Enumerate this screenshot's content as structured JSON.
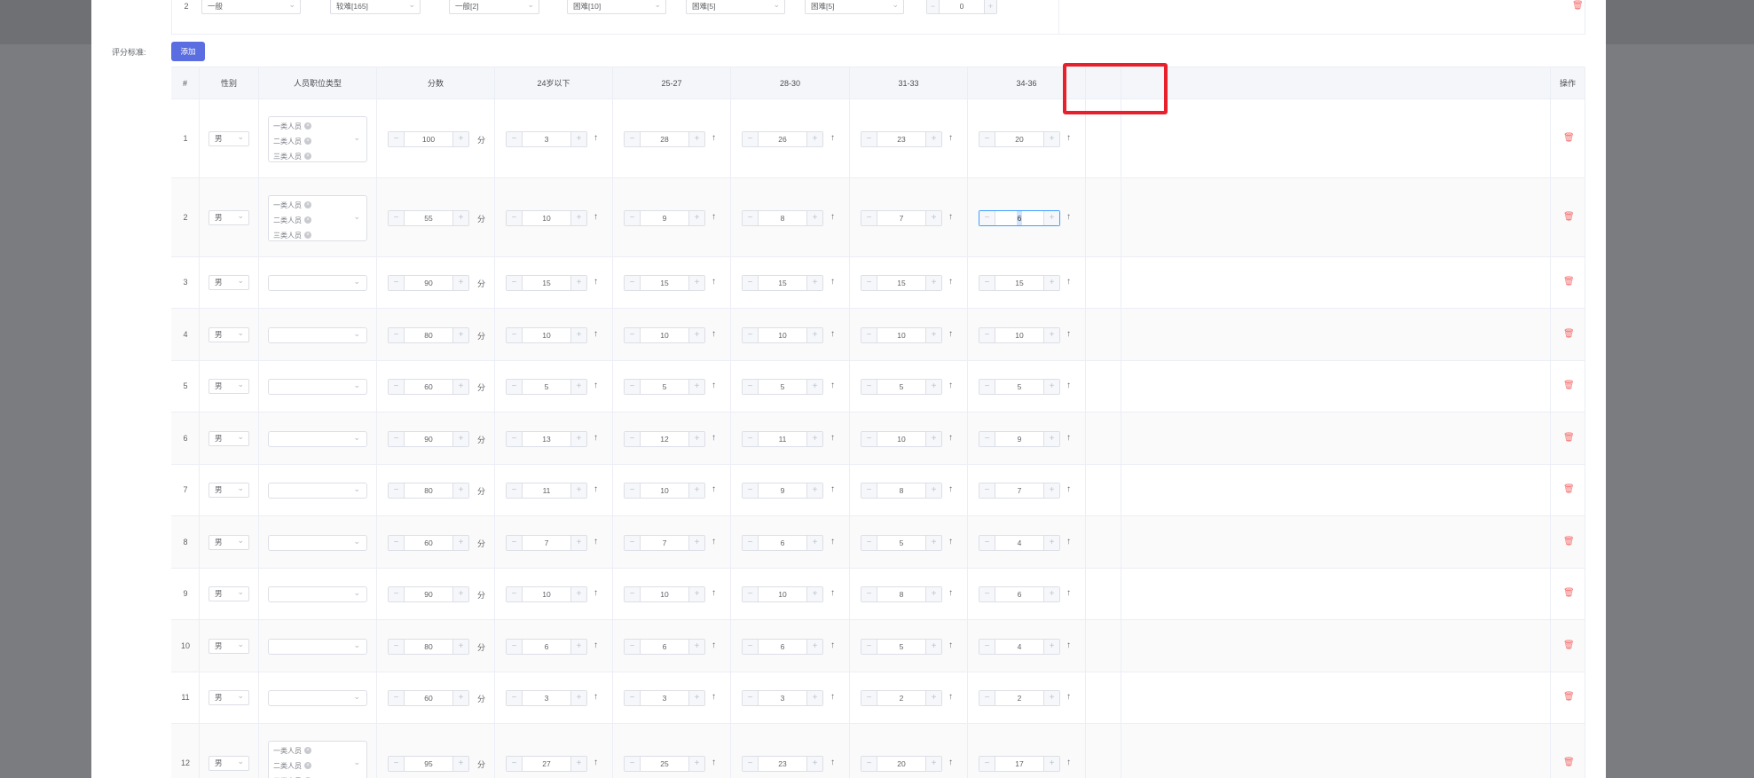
{
  "top_row": {
    "index": "2",
    "selects": [
      "一般",
      "较难[165]",
      "一般[2]",
      "困难[10]",
      "困难[5]",
      "困难[5]"
    ],
    "number": "0"
  },
  "scoring": {
    "label": "评分标准:",
    "add_button": "添加"
  },
  "columns": {
    "index": "#",
    "gender": "性别",
    "position_type": "人员职位类型",
    "score": "分数",
    "age_columns": [
      "24岁以下",
      "25-27",
      "28-30",
      "31-33",
      "34-36"
    ],
    "actions": "操作"
  },
  "unit_label": "分",
  "arrow_icon": "↑",
  "tags": [
    "一类人员",
    "二类人员",
    "三类人员"
  ],
  "rows": [
    {
      "index": "1",
      "gender": "男",
      "tags": true,
      "score": "100",
      "ages": [
        "3",
        "28",
        "26",
        "23",
        "20"
      ]
    },
    {
      "index": "2",
      "gender": "男",
      "tags": true,
      "score": "55",
      "ages": [
        "10",
        "9",
        "8",
        "7",
        "6"
      ],
      "focus_col": 4
    },
    {
      "index": "3",
      "gender": "男",
      "tags": false,
      "score": "90",
      "ages": [
        "15",
        "15",
        "15",
        "15",
        "15"
      ]
    },
    {
      "index": "4",
      "gender": "男",
      "tags": false,
      "score": "80",
      "ages": [
        "10",
        "10",
        "10",
        "10",
        "10"
      ]
    },
    {
      "index": "5",
      "gender": "男",
      "tags": false,
      "score": "60",
      "ages": [
        "5",
        "5",
        "5",
        "5",
        "5"
      ]
    },
    {
      "index": "6",
      "gender": "男",
      "tags": false,
      "score": "90",
      "ages": [
        "13",
        "12",
        "11",
        "10",
        "9"
      ]
    },
    {
      "index": "7",
      "gender": "男",
      "tags": false,
      "score": "80",
      "ages": [
        "11",
        "10",
        "9",
        "8",
        "7"
      ]
    },
    {
      "index": "8",
      "gender": "男",
      "tags": false,
      "score": "60",
      "ages": [
        "7",
        "7",
        "6",
        "5",
        "4"
      ]
    },
    {
      "index": "9",
      "gender": "男",
      "tags": false,
      "score": "90",
      "ages": [
        "10",
        "10",
        "10",
        "8",
        "6"
      ]
    },
    {
      "index": "10",
      "gender": "男",
      "tags": false,
      "score": "80",
      "ages": [
        "6",
        "6",
        "6",
        "5",
        "4"
      ]
    },
    {
      "index": "11",
      "gender": "男",
      "tags": false,
      "score": "60",
      "ages": [
        "3",
        "3",
        "3",
        "2",
        "2"
      ]
    },
    {
      "index": "12",
      "gender": "男",
      "tags": true,
      "score": "95",
      "ages": [
        "27",
        "25",
        "23",
        "20",
        "17"
      ]
    }
  ]
}
